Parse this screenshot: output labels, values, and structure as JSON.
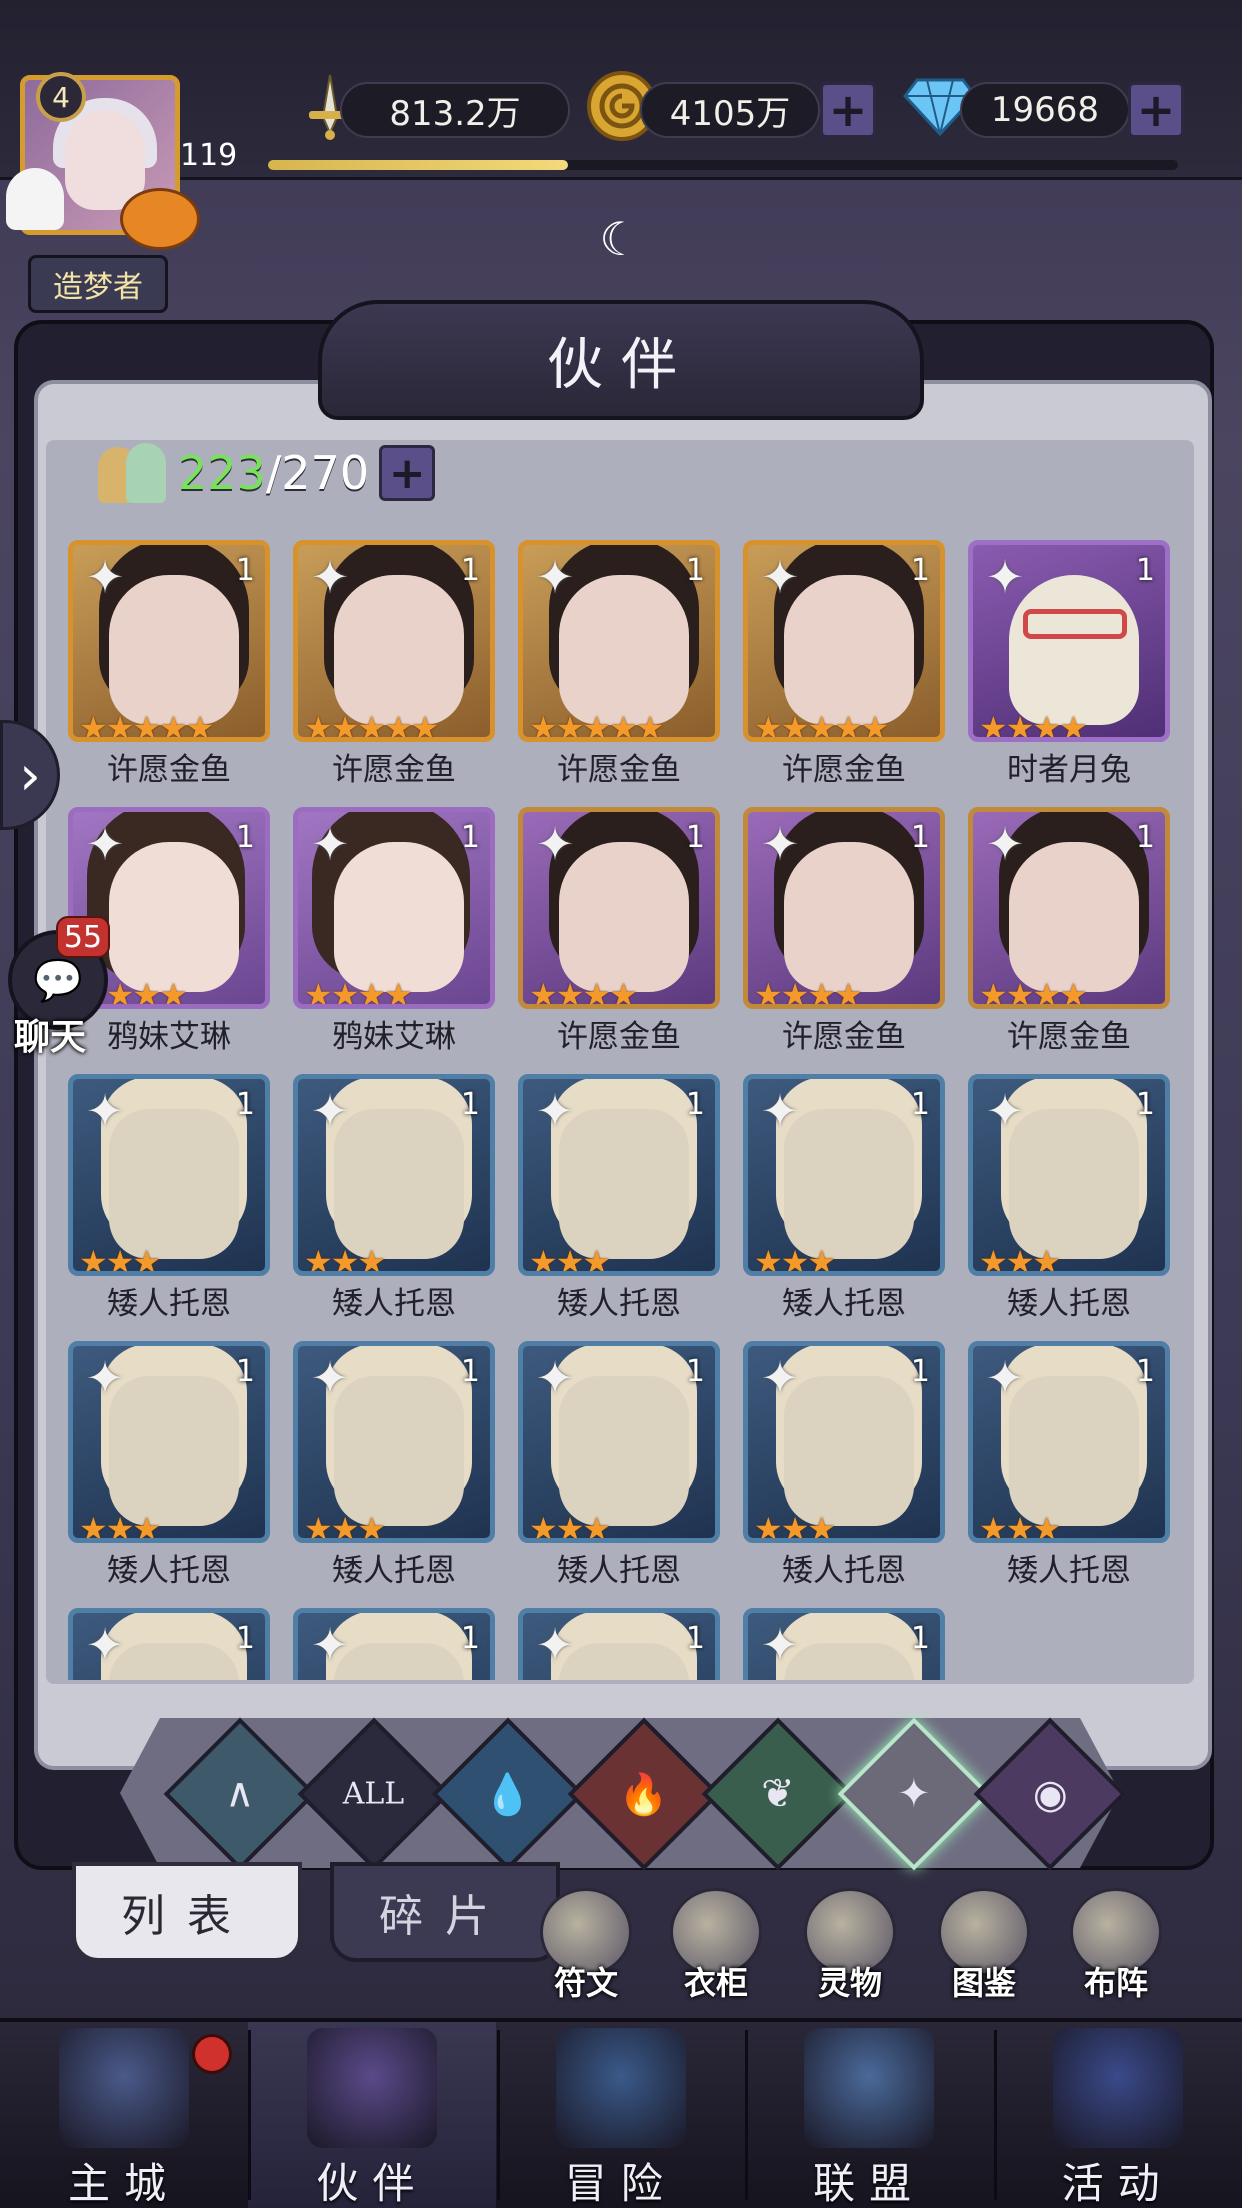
{
  "header": {
    "level": "4",
    "avatar_count": "119",
    "title_badge": "造梦者",
    "resources": {
      "power": "813.2万",
      "gold": "4105万",
      "diamonds": "19668"
    },
    "exp_fraction": 0.33
  },
  "panel": {
    "title": "伙伴",
    "count_current": "223",
    "count_max": "/270"
  },
  "heroes": [
    {
      "name": "许愿金鱼",
      "level": "1",
      "stars": "★★★★★",
      "style": "gold"
    },
    {
      "name": "许愿金鱼",
      "level": "1",
      "stars": "★★★★★",
      "style": "gold"
    },
    {
      "name": "许愿金鱼",
      "level": "1",
      "stars": "★★★★★",
      "style": "gold"
    },
    {
      "name": "许愿金鱼",
      "level": "1",
      "stars": "★★★★★",
      "style": "gold"
    },
    {
      "name": "时者月兔",
      "level": "1",
      "stars": "★★★★",
      "style": "rabbit"
    },
    {
      "name": "鸦妹艾琳",
      "level": "1",
      "stars": "★★★★",
      "style": "purple2"
    },
    {
      "name": "鸦妹艾琳",
      "level": "1",
      "stars": "★★★★",
      "style": "purple2"
    },
    {
      "name": "许愿金鱼",
      "level": "1",
      "stars": "★★★★",
      "style": "purple"
    },
    {
      "name": "许愿金鱼",
      "level": "1",
      "stars": "★★★★",
      "style": "purple"
    },
    {
      "name": "许愿金鱼",
      "level": "1",
      "stars": "★★★★",
      "style": "purple"
    },
    {
      "name": "矮人托恩",
      "level": "1",
      "stars": "★★★",
      "style": "blue"
    },
    {
      "name": "矮人托恩",
      "level": "1",
      "stars": "★★★",
      "style": "blue"
    },
    {
      "name": "矮人托恩",
      "level": "1",
      "stars": "★★★",
      "style": "blue"
    },
    {
      "name": "矮人托恩",
      "level": "1",
      "stars": "★★★",
      "style": "blue"
    },
    {
      "name": "矮人托恩",
      "level": "1",
      "stars": "★★★",
      "style": "blue"
    },
    {
      "name": "矮人托恩",
      "level": "1",
      "stars": "★★★",
      "style": "blue"
    },
    {
      "name": "矮人托恩",
      "level": "1",
      "stars": "★★★",
      "style": "blue"
    },
    {
      "name": "矮人托恩",
      "level": "1",
      "stars": "★★★",
      "style": "blue"
    },
    {
      "name": "矮人托恩",
      "level": "1",
      "stars": "★★★",
      "style": "blue"
    },
    {
      "name": "矮人托恩",
      "level": "1",
      "stars": "★★★",
      "style": "blue"
    },
    {
      "name": "",
      "level": "1",
      "stars": "",
      "style": "blue"
    },
    {
      "name": "",
      "level": "1",
      "stars": "",
      "style": "blue"
    },
    {
      "name": "",
      "level": "1",
      "stars": "",
      "style": "blue"
    },
    {
      "name": "",
      "level": "1",
      "stars": "",
      "style": "blue"
    }
  ],
  "filters": [
    {
      "icon": "wind-element-icon",
      "label": "",
      "color": "#3e5a6a"
    },
    {
      "icon": "all-filter-icon",
      "label": "ALL",
      "color": "#2b2a3c"
    },
    {
      "icon": "water-element-icon",
      "label": "",
      "color": "#2f5070"
    },
    {
      "icon": "fire-element-icon",
      "label": "",
      "color": "#6a3232"
    },
    {
      "icon": "nature-element-icon",
      "label": "",
      "color": "#3a5e4e"
    },
    {
      "icon": "light-element-icon",
      "label": "",
      "color": "#6c6a78",
      "selected": true
    },
    {
      "icon": "dark-element-icon",
      "label": "",
      "color": "#4c3a60"
    }
  ],
  "tabs": {
    "list": "列表",
    "fragments": "碎片"
  },
  "quick_actions": [
    {
      "label": "符文",
      "icon": "rune-icon"
    },
    {
      "label": "衣柜",
      "icon": "wardrobe-icon"
    },
    {
      "label": "灵物",
      "icon": "spirit-icon"
    },
    {
      "label": "图鉴",
      "icon": "codex-icon"
    },
    {
      "label": "布阵",
      "icon": "formation-icon"
    }
  ],
  "chat": {
    "badge": "55",
    "label": "聊天"
  },
  "nav": [
    {
      "label": "主城",
      "icon": "castle-icon",
      "color": "#4a5a8a",
      "active": false
    },
    {
      "label": "伙伴",
      "icon": "witch-hat-icon",
      "color": "#5b4a8a",
      "active": true
    },
    {
      "label": "冒险",
      "icon": "compass-icon",
      "color": "#3a5a8a",
      "active": false
    },
    {
      "label": "联盟",
      "icon": "shield-icon",
      "color": "#4a6a9a",
      "active": false
    },
    {
      "label": "活动",
      "icon": "cards-icon",
      "color": "#3a4a8a",
      "active": false
    }
  ],
  "colors": {
    "accent_purple": "#5a4f88",
    "count_green": "#78e25c",
    "star_orange": "#f39a2a"
  }
}
